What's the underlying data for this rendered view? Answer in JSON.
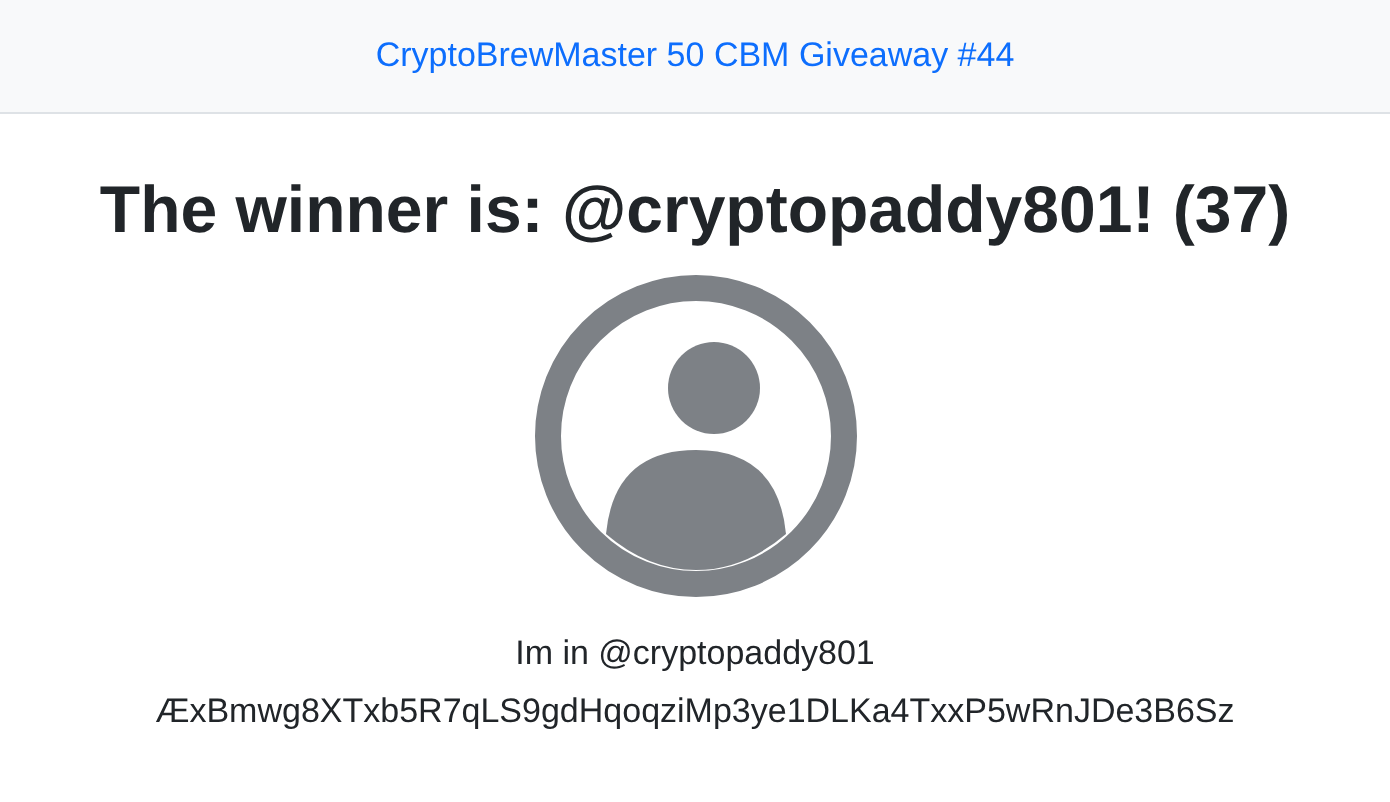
{
  "header": {
    "title": "CryptoBrewMaster 50 CBM Giveaway #44"
  },
  "winner": {
    "heading": "The winner is: @cryptopaddy801! (37)",
    "message": "Im in @cryptopaddy801",
    "address": "ÆxBmwg8XTxb5R7qLS9gdHqoqziMp3ye1DLKa4TxxP5wRnJDe3B6Sz"
  }
}
